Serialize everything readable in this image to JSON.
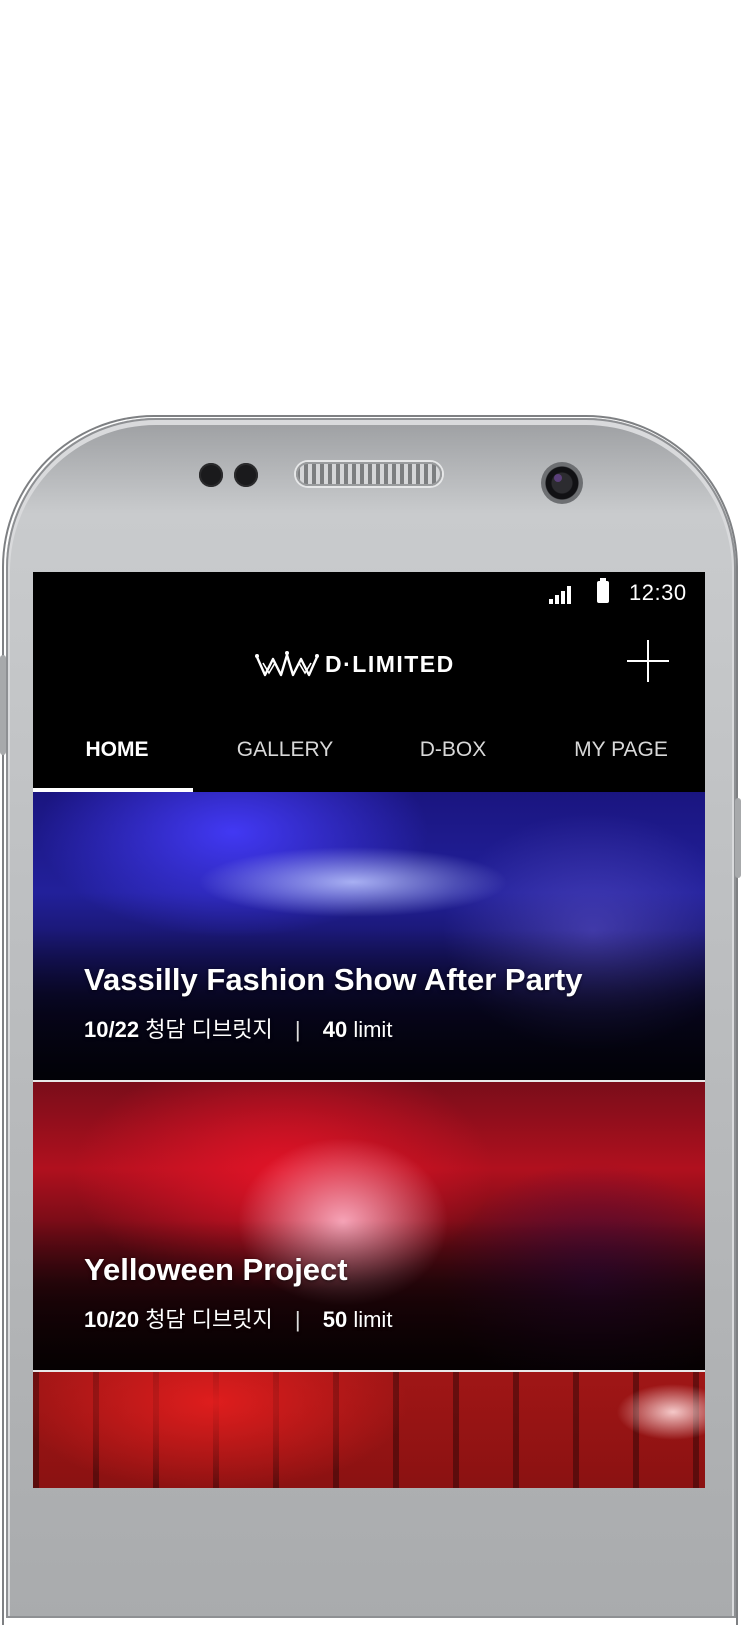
{
  "status_bar": {
    "time": "12:30",
    "signal_icon": "signal-icon",
    "battery_icon": "battery-icon"
  },
  "header": {
    "logo_text": "D·LIMITED",
    "logo_icon": "crown-icon",
    "add_icon": "plus-icon"
  },
  "tabs": [
    {
      "label": "HOME",
      "active": true
    },
    {
      "label": "GALLERY",
      "active": false
    },
    {
      "label": "D-BOX",
      "active": false
    },
    {
      "label": "MY PAGE",
      "active": false
    }
  ],
  "events": [
    {
      "title": "Vassilly Fashion Show After Party",
      "date": "10/22",
      "venue": "청담 디브릿지",
      "separator": "|",
      "count": "40",
      "unit": "limit"
    },
    {
      "title": "Yelloween Project",
      "date": "10/20",
      "venue": "청담 디브릿지",
      "separator": "|",
      "count": "50",
      "unit": "limit"
    },
    {
      "title": "",
      "date": "",
      "venue": "",
      "separator": "",
      "count": "",
      "unit": ""
    }
  ],
  "colors": {
    "background": "#000000",
    "text": "#ffffff",
    "card1_tint": "#2a25b0",
    "card2_tint": "#c0121f",
    "card3_tint": "#a01616"
  }
}
